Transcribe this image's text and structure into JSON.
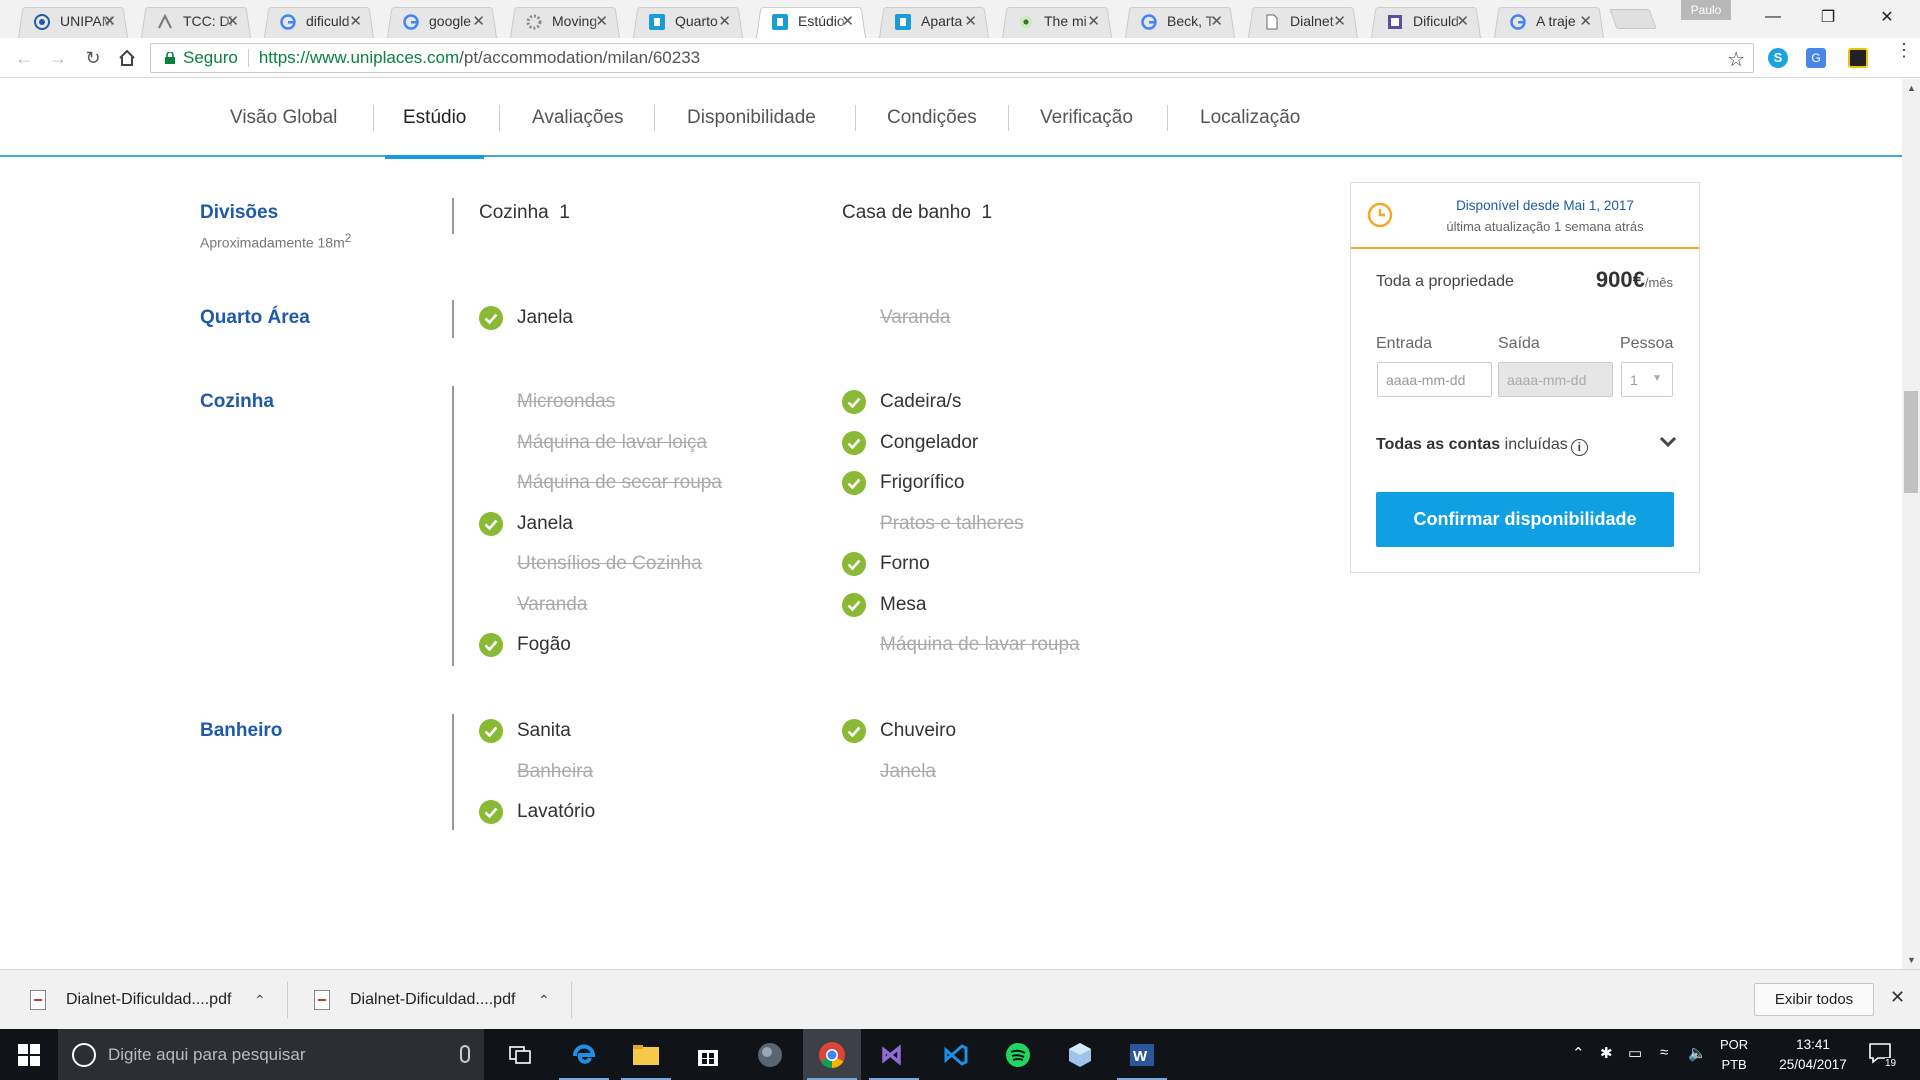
{
  "browser": {
    "tabs": [
      {
        "title": "UNIPAM",
        "icon": "unipam-icon"
      },
      {
        "title": "TCC: Di",
        "icon": "tcc-icon"
      },
      {
        "title": "dificuld",
        "icon": "google-icon"
      },
      {
        "title": "google",
        "icon": "google-icon"
      },
      {
        "title": "Moving",
        "icon": "gear-icon"
      },
      {
        "title": "Quarto",
        "icon": "uniplaces-icon"
      },
      {
        "title": "Estúdio",
        "icon": "uniplaces-icon",
        "active": true
      },
      {
        "title": "Aparta",
        "icon": "uniplaces-icon"
      },
      {
        "title": "The mi",
        "icon": "circle-icon"
      },
      {
        "title": "Beck, T",
        "icon": "google-icon"
      },
      {
        "title": "Dialnet",
        "icon": "document-icon"
      },
      {
        "title": "Dificuld",
        "icon": "doc-purple-icon"
      },
      {
        "title": "A traje",
        "icon": "google-icon"
      }
    ],
    "profile": "Paulo",
    "security_label": "Seguro",
    "url_host": "https://www.uniplaces.com",
    "url_path": "/pt/accommodation/milan/60233"
  },
  "page_nav": [
    {
      "label": "Visão Global"
    },
    {
      "label": "Estúdio",
      "active": true
    },
    {
      "label": "Avaliações"
    },
    {
      "label": "Disponibilidade"
    },
    {
      "label": "Condições"
    },
    {
      "label": "Verificação"
    },
    {
      "label": "Localização"
    }
  ],
  "sections": {
    "divisoes": {
      "title": "Divisões",
      "subtitle": "Aproximadamente 18m",
      "subtitle_sup": "2",
      "col1": {
        "label": "Cozinha",
        "count": "1"
      },
      "col2": {
        "label": "Casa de banho",
        "count": "1"
      }
    },
    "quarto": {
      "title": "Quarto Área",
      "col1": [
        {
          "label": "Janela",
          "available": true
        }
      ],
      "col2": [
        {
          "label": "Varanda",
          "available": false
        }
      ]
    },
    "cozinha": {
      "title": "Cozinha",
      "col1": [
        {
          "label": "Microondas",
          "available": false
        },
        {
          "label": "Máquina de lavar loiça",
          "available": false
        },
        {
          "label": "Máquina de secar roupa",
          "available": false
        },
        {
          "label": "Janela",
          "available": true
        },
        {
          "label": "Utensílios de Cozinha",
          "available": false
        },
        {
          "label": "Varanda",
          "available": false
        },
        {
          "label": "Fogão",
          "available": true
        }
      ],
      "col2": [
        {
          "label": "Cadeira/s",
          "available": true
        },
        {
          "label": "Congelador",
          "available": true
        },
        {
          "label": "Frigorífico",
          "available": true
        },
        {
          "label": "Pratos e talheres",
          "available": false
        },
        {
          "label": "Forno",
          "available": true
        },
        {
          "label": "Mesa",
          "available": true
        },
        {
          "label": "Máquina de lavar roupa",
          "available": false
        }
      ]
    },
    "banheiro": {
      "title": "Banheiro",
      "col1": [
        {
          "label": "Sanita",
          "available": true
        },
        {
          "label": "Banheira",
          "available": false
        },
        {
          "label": "Lavatório",
          "available": true
        }
      ],
      "col2": [
        {
          "label": "Chuveiro",
          "available": true
        },
        {
          "label": "Janela",
          "available": false
        }
      ]
    }
  },
  "booking": {
    "availability": "Disponível desde Mai 1, 2017",
    "updated": "última atualização 1 semana atrás",
    "property_label": "Toda a propriedade",
    "price": "900€",
    "price_unit": "/mês",
    "entrada_label": "Entrada",
    "saida_label": "Saída",
    "pessoa_label": "Pessoa",
    "entrada_placeholder": "aaaa-mm-dd",
    "saida_placeholder": "aaaa-mm-dd",
    "pessoa_value": "1",
    "bills_bold": "Todas as contas",
    "bills_rest": " incluídas",
    "confirm_label": "Confirmar disponibilidade"
  },
  "downloads": {
    "items": [
      {
        "name": "Dialnet-Dificuldad....pdf"
      },
      {
        "name": "Dialnet-Dificuldad....pdf"
      }
    ],
    "show_all": "Exibir todos"
  },
  "taskbar": {
    "search_placeholder": "Digite aqui para pesquisar",
    "apps": [
      "task-view-icon",
      "edge-icon",
      "file-explorer-icon",
      "store-icon",
      "ball-icon",
      "chrome-icon",
      "visual-studio-icon",
      "vscode-icon",
      "spotify-icon",
      "box-icon",
      "word-icon"
    ],
    "lang1": "POR",
    "lang2": "PTB",
    "time": "13:41",
    "date": "25/04/2017",
    "notifications": "19"
  },
  "colors": {
    "accent_blue": "#1a9cd8",
    "section_title": "#1e5aa8",
    "check_green": "#8ab935",
    "button_blue": "#0ea0e3",
    "orange": "#f5a623"
  }
}
